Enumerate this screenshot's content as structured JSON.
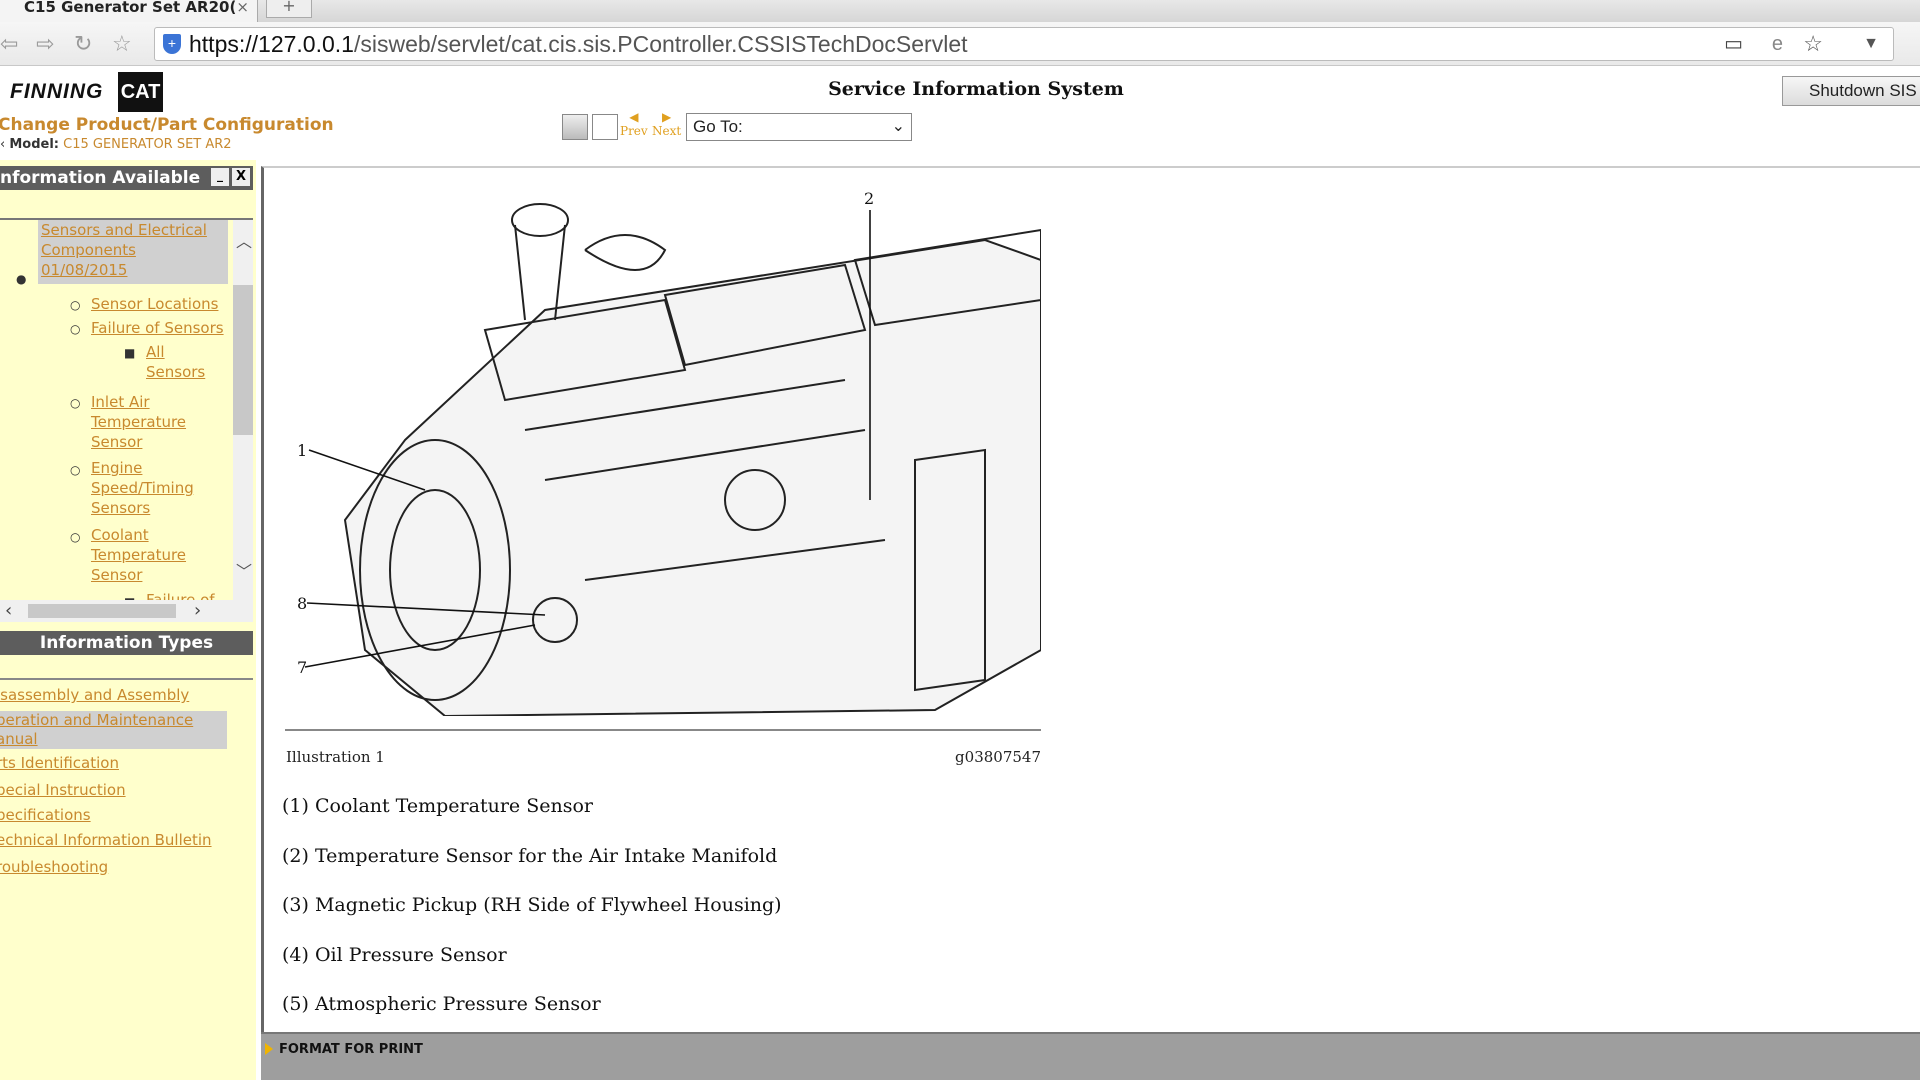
{
  "browser": {
    "tab_title": "C15 Generator Set AR20(",
    "new_tab": "+",
    "url_host": "https://127.0.0.1",
    "url_path": "/sisweb/servlet/cat.cis.sis.PController.CSSISTechDocServlet"
  },
  "header": {
    "logo_text": "FINNING",
    "logo_cat": "CAT",
    "title": "Service Information System",
    "shutdown_label": "Shutdown SIS",
    "change_config": "Change Product/Part Configuration",
    "model_label": "Model:",
    "model_value": "C15 GENERATOR SET AR2",
    "prev": "Prev",
    "next": "Next",
    "goto_value": "Go To:"
  },
  "sidebar": {
    "info_available_title": "nformation Available",
    "tree": [
      {
        "label": "Sensors and Electrical Components 01/08/2015",
        "level": 0
      },
      {
        "label": "Sensor Locations",
        "level": 1
      },
      {
        "label": "Failure of Sensors",
        "level": 1
      },
      {
        "label": "All Sensors",
        "level": 2
      },
      {
        "label": "Inlet Air Temperature Sensor",
        "level": 1
      },
      {
        "label": "Engine Speed/Timing Sensors",
        "level": 1
      },
      {
        "label": "Coolant Temperature Sensor",
        "level": 1
      },
      {
        "label": "Failure of",
        "level": 2
      }
    ],
    "info_types_title": "Information Types",
    "types": [
      "isassembly and Assembly",
      "peration and Maintenance anual",
      "rts Identification",
      "pecial Instruction",
      "pecifications",
      "echnical Information Bulletin",
      "roubleshooting"
    ]
  },
  "document": {
    "callouts": [
      "1",
      "2",
      "7",
      "8"
    ],
    "illustration_label": "Illustration 1",
    "illustration_id": "g03807547",
    "items": [
      "(1) Coolant Temperature Sensor",
      "(2) Temperature Sensor for the Air Intake Manifold",
      "(3) Magnetic Pickup (RH Side of Flywheel Housing)",
      "(4) Oil Pressure Sensor",
      "(5) Atmospheric Pressure Sensor"
    ]
  },
  "footer": {
    "format_print": "FORMAT FOR PRINT"
  },
  "colors": {
    "link": "#c8892e",
    "panel_bg": "#ffffcc",
    "panel_header": "#5d5d5d"
  }
}
